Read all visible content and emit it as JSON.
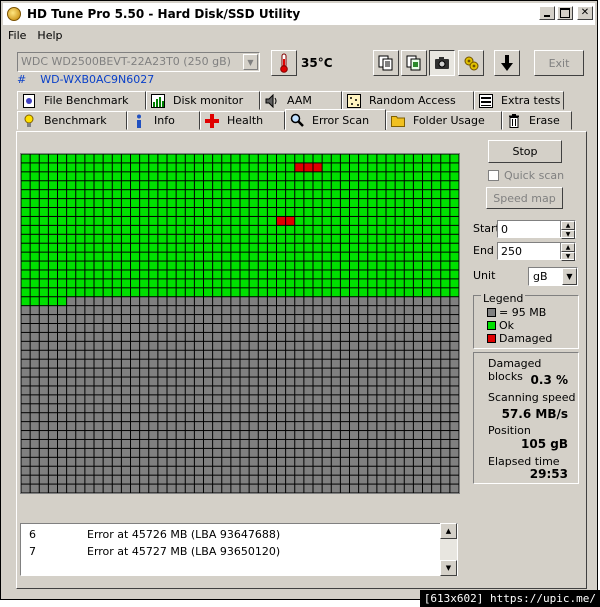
{
  "window": {
    "title": "HD Tune Pro 5.50 - Hard Disk/SSD Utility"
  },
  "menu": [
    "File",
    "Help"
  ],
  "toolbar": {
    "drive": "WDC WD2500BEVT-22A23T0 (250 gB)",
    "serial_prefix": "#",
    "serial": "WD-WXB0AC9N6027",
    "temperature": "35°C",
    "exit_label": "Exit",
    "icons": [
      "copy-text-icon",
      "copy-info-icon",
      "screenshot-camera-icon",
      "options-icon",
      "save-down-icon"
    ]
  },
  "tabs": {
    "row1": [
      {
        "label": "File Benchmark",
        "icon": "file-benchmark-icon"
      },
      {
        "label": "Disk monitor",
        "icon": "disk-monitor-icon"
      },
      {
        "label": "AAM",
        "icon": "speaker-icon"
      },
      {
        "label": "Random Access",
        "icon": "random-access-icon"
      },
      {
        "label": "Extra tests",
        "icon": "extra-tests-icon"
      }
    ],
    "row2": [
      {
        "label": "Benchmark",
        "icon": "bulb-icon"
      },
      {
        "label": "Info",
        "icon": "info-icon"
      },
      {
        "label": "Health",
        "icon": "health-cross-icon"
      },
      {
        "label": "Error Scan",
        "icon": "magnifier-icon",
        "active": true
      },
      {
        "label": "Folder Usage",
        "icon": "folder-icon"
      },
      {
        "label": "Erase",
        "icon": "trash-icon"
      }
    ]
  },
  "controls": {
    "stop": "Stop",
    "quick_scan": "Quick scan",
    "quick_scan_checked": false,
    "speed_map": "Speed map",
    "start_label": "Start",
    "start_value": "0",
    "end_label": "End",
    "end_value": "250",
    "unit_label": "Unit",
    "unit_value": "gB"
  },
  "legend": {
    "title": "Legend",
    "items": [
      {
        "label": "= 95 MB",
        "color": "#808080"
      },
      {
        "label": "Ok",
        "color": "#00e000"
      },
      {
        "label": "Damaged",
        "color": "#e00000"
      }
    ]
  },
  "stats": {
    "damaged_blocks_label": "Damaged blocks",
    "damaged_blocks_value": "0.3 %",
    "scanning_speed_label": "Scanning speed",
    "scanning_speed_value": "57.6 MB/s",
    "position_label": "Position",
    "position_value": "105 gB",
    "elapsed_label": "Elapsed time",
    "elapsed_value": "29:53"
  },
  "log": [
    {
      "num": "6",
      "msg": "Error at 45726 MB (LBA 93647688)"
    },
    {
      "num": "7",
      "msg": "Error at 45727 MB (LBA 93650120)"
    }
  ],
  "scan_grid": {
    "columns": 48,
    "rows": 38,
    "ok_full_rows": 16,
    "ok_partial_cols": 5,
    "damaged_cells": [
      [
        1,
        30
      ],
      [
        1,
        31
      ],
      [
        1,
        32
      ],
      [
        7,
        28
      ],
      [
        7,
        29
      ]
    ],
    "colors": {
      "ok": "#00e000",
      "untested": "#808080",
      "damaged": "#e00000",
      "grid": "#000000"
    }
  },
  "watermark": "[613x602] https://upic.me/"
}
